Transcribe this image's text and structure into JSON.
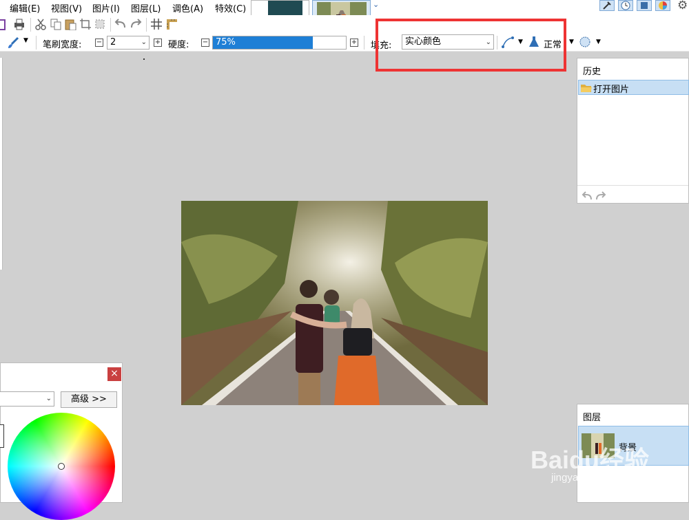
{
  "menu": [
    {
      "key": "edit",
      "label": "编辑(E)"
    },
    {
      "key": "view",
      "label": "视图(V)"
    },
    {
      "key": "image",
      "label": "图片(I)"
    },
    {
      "key": "layers",
      "label": "图层(L)"
    },
    {
      "key": "adjust",
      "label": "调色(A)"
    },
    {
      "key": "effects",
      "label": "特效(C)"
    }
  ],
  "toolbar2": {
    "brush_width_label": "笔刷宽度:",
    "brush_width_value": "2",
    "hardness_label": "硬度:",
    "hardness_value": "75%",
    "hardness_level": 0.75,
    "fill_label": "填充:",
    "fill_value": "实心颜色",
    "blend_mode": "正常"
  },
  "history_panel": {
    "title": "历史",
    "items": [
      {
        "label": "打开图片"
      }
    ]
  },
  "layers_panel": {
    "title": "图层",
    "items": [
      {
        "label": "背景"
      }
    ]
  },
  "color_window": {
    "advanced_button": "高级 >>",
    "close_icon": "×"
  },
  "watermark": {
    "brand": "Baidu经验",
    "url": "jingyan.baidu.com"
  },
  "colors": {
    "highlight": "#ee3333",
    "selection": "#c7dff4",
    "hardness_fill": "#1e7fd6"
  }
}
